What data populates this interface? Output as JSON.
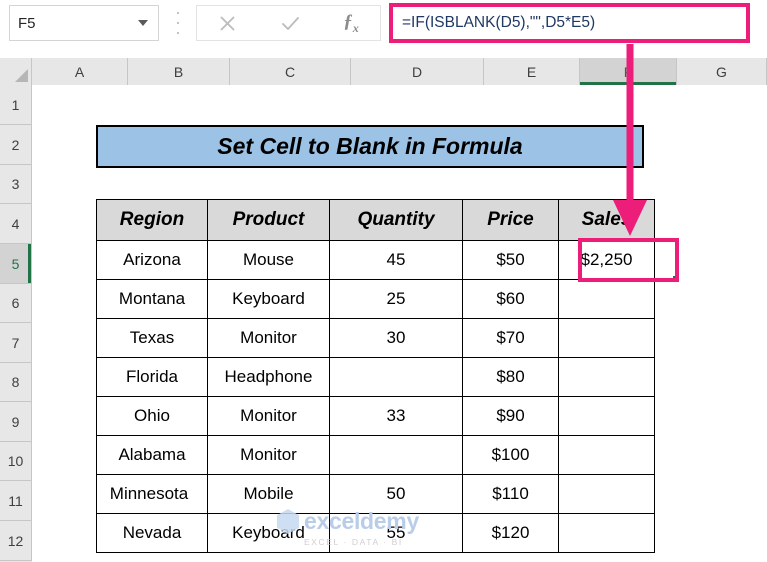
{
  "formula_bar": {
    "name_box_value": "F5",
    "name_box_dropdown_icon": "chevron-down-icon",
    "cancel_icon": "x-cancel-icon",
    "confirm_icon": "checkmark-confirm-icon",
    "function_icon": "fx-insert-function-icon",
    "formula_value": "=IF(ISBLANK(D5),\"\",D5*E5)",
    "highlight_color": "#ec1e79"
  },
  "grid": {
    "select_all_icon": "select-all-corner-icon",
    "column_headers": [
      "A",
      "B",
      "C",
      "D",
      "E",
      "F",
      "G"
    ],
    "selected_column": "F",
    "row_headers": [
      "1",
      "2",
      "3",
      "4",
      "5",
      "6",
      "7",
      "8",
      "9",
      "10",
      "11",
      "12"
    ],
    "selected_row": "5",
    "selection_color": "#217346"
  },
  "banner": {
    "title": "Set Cell to Blank in Formula",
    "fill_color": "#9cc3e5"
  },
  "table": {
    "headers": [
      "Region",
      "Product",
      "Quantity",
      "Price",
      "Sales"
    ],
    "header_fill": "#d9d9d9",
    "rows": [
      {
        "region": "Arizona",
        "product": "Mouse",
        "quantity": "45",
        "price": "$50",
        "sales": "$2,250"
      },
      {
        "region": "Montana",
        "product": "Keyboard",
        "quantity": "25",
        "price": "$60",
        "sales": ""
      },
      {
        "region": "Texas",
        "product": "Monitor",
        "quantity": "30",
        "price": "$70",
        "sales": ""
      },
      {
        "region": "Florida",
        "product": "Headphone",
        "quantity": "",
        "price": "$80",
        "sales": ""
      },
      {
        "region": "Ohio",
        "product": "Monitor",
        "quantity": "33",
        "price": "$90",
        "sales": ""
      },
      {
        "region": "Alabama",
        "product": "Monitor",
        "quantity": "",
        "price": "$100",
        "sales": ""
      },
      {
        "region": "Minnesota",
        "product": "Mobile",
        "quantity": "50",
        "price": "$110",
        "sales": ""
      },
      {
        "region": "Nevada",
        "product": "Keyboard",
        "quantity": "55",
        "price": "$120",
        "sales": ""
      }
    ]
  },
  "annotation": {
    "arrow_icon": "down-arrow-annotation-icon",
    "arrow_color": "#ec1e79",
    "selected_cell_highlight": "#ec1e79"
  },
  "watermark": {
    "name": "exceldemy",
    "tagline": "EXCEL  ·  DATA  ·  BI",
    "logo_icon": "hexagon-logo-icon"
  }
}
